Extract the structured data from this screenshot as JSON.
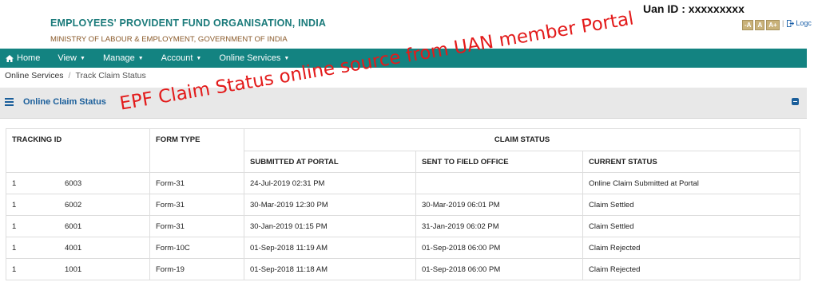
{
  "header": {
    "org_name": "EMPLOYEES' PROVIDENT FUND ORGANISATION, INDIA",
    "ministry": "MINISTRY OF LABOUR & EMPLOYMENT, GOVERNMENT OF INDIA",
    "uan": "Uan ID : xxxxxxxxx",
    "font_buttons": [
      "-A",
      "A",
      "A+"
    ],
    "logout": "Logc"
  },
  "nav": {
    "items": [
      {
        "label": "Home",
        "icon": "home-icon"
      },
      {
        "label": "View"
      },
      {
        "label": "Manage"
      },
      {
        "label": "Account"
      },
      {
        "label": "Online Services"
      }
    ]
  },
  "breadcrumb": {
    "parent": "Online Services",
    "current": "Track Claim Status"
  },
  "panel": {
    "title": "Online Claim Status"
  },
  "watermark": "EPF Claim Status online source from UAN member Portal",
  "table": {
    "headers": {
      "tracking_id": "TRACKING ID",
      "form_type": "FORM TYPE",
      "claim_status": "CLAIM STATUS",
      "submitted": "SUBMITTED AT PORTAL",
      "sent": "SENT TO FIELD OFFICE",
      "current": "CURRENT STATUS"
    },
    "rows": [
      {
        "serial": "1",
        "id": "6003",
        "form": "Form-31",
        "submitted": "24-Jul-2019 02:31 PM",
        "sent": "",
        "status": "Online Claim Submitted at Portal"
      },
      {
        "serial": "1",
        "id": "6002",
        "form": "Form-31",
        "submitted": "30-Mar-2019 12:30 PM",
        "sent": "30-Mar-2019 06:01 PM",
        "status": "Claim Settled"
      },
      {
        "serial": "1",
        "id": "6001",
        "form": "Form-31",
        "submitted": "30-Jan-2019 01:15 PM",
        "sent": "31-Jan-2019 06:02 PM",
        "status": "Claim Settled"
      },
      {
        "serial": "1",
        "id": "4001",
        "form": "Form-10C",
        "submitted": "01-Sep-2018 11:19 AM",
        "sent": "01-Sep-2018 06:00 PM",
        "status": "Claim Rejected"
      },
      {
        "serial": "1",
        "id": "1001",
        "form": "Form-19",
        "submitted": "01-Sep-2018 11:18 AM",
        "sent": "01-Sep-2018 06:00 PM",
        "status": "Claim Rejected"
      }
    ]
  }
}
